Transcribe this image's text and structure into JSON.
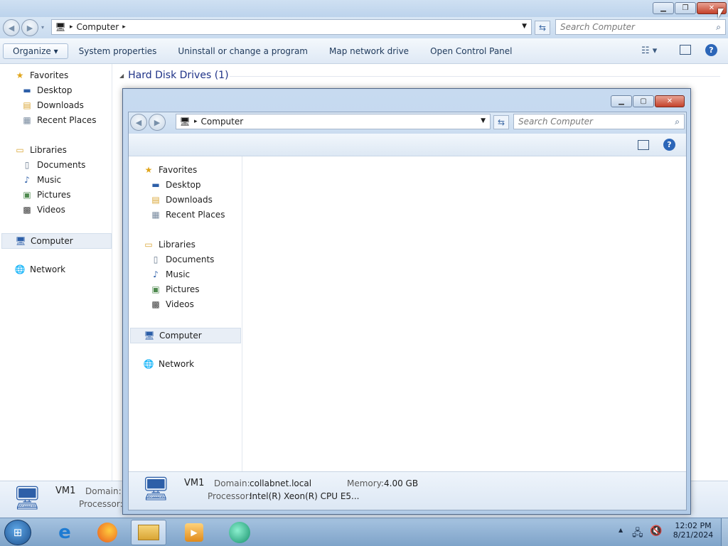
{
  "main": {
    "address": {
      "crumb": "Computer"
    },
    "search_placeholder": "Search Computer",
    "toolbar": {
      "organize": "Organize",
      "system_properties": "System properties",
      "uninstall": "Uninstall or change a program",
      "map_drive": "Map network drive",
      "control_panel": "Open Control Panel"
    },
    "nav": {
      "favorites": "Favorites",
      "desktop": "Desktop",
      "downloads": "Downloads",
      "recent": "Recent Places",
      "libraries": "Libraries",
      "documents": "Documents",
      "music": "Music",
      "pictures": "Pictures",
      "videos": "Videos",
      "computer": "Computer",
      "network": "Network"
    },
    "group_header": "Hard Disk Drives (1)",
    "details": {
      "name": "VM1",
      "domain_label": "Domain:",
      "processor_label": "Processor:"
    }
  },
  "child": {
    "address": {
      "crumb": "Computer"
    },
    "search_placeholder": "Search Computer",
    "nav": {
      "favorites": "Favorites",
      "desktop": "Desktop",
      "downloads": "Downloads",
      "recent": "Recent Places",
      "libraries": "Libraries",
      "documents": "Documents",
      "music": "Music",
      "pictures": "Pictures",
      "videos": "Videos",
      "computer": "Computer",
      "network": "Network"
    },
    "details": {
      "name": "VM1",
      "domain_label": "Domain:",
      "domain": "collabnet.local",
      "memory_label": "Memory:",
      "memory": "4.00 GB",
      "processor_label": "Processor:",
      "processor": "Intel(R) Xeon(R) CPU E5..."
    }
  },
  "taskbar": {
    "time": "12:02 PM",
    "date": "8/21/2024"
  }
}
